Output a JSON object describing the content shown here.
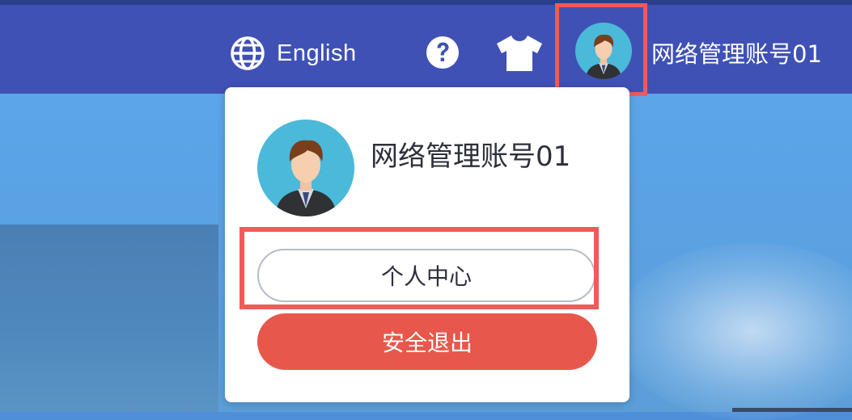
{
  "header": {
    "language_label": "English",
    "username": "网络管理账号01"
  },
  "icons": {
    "language": "globe-icon",
    "help": "question-icon",
    "theme": "tshirt-icon",
    "avatar": "user-avatar"
  },
  "dropdown": {
    "username": "网络管理账号01",
    "profile_button": "个人中心",
    "logout_button": "安全退出"
  },
  "colors": {
    "topbar": "#3f51b5",
    "highlight": "#f05a5a",
    "logout": "#e8574b"
  }
}
